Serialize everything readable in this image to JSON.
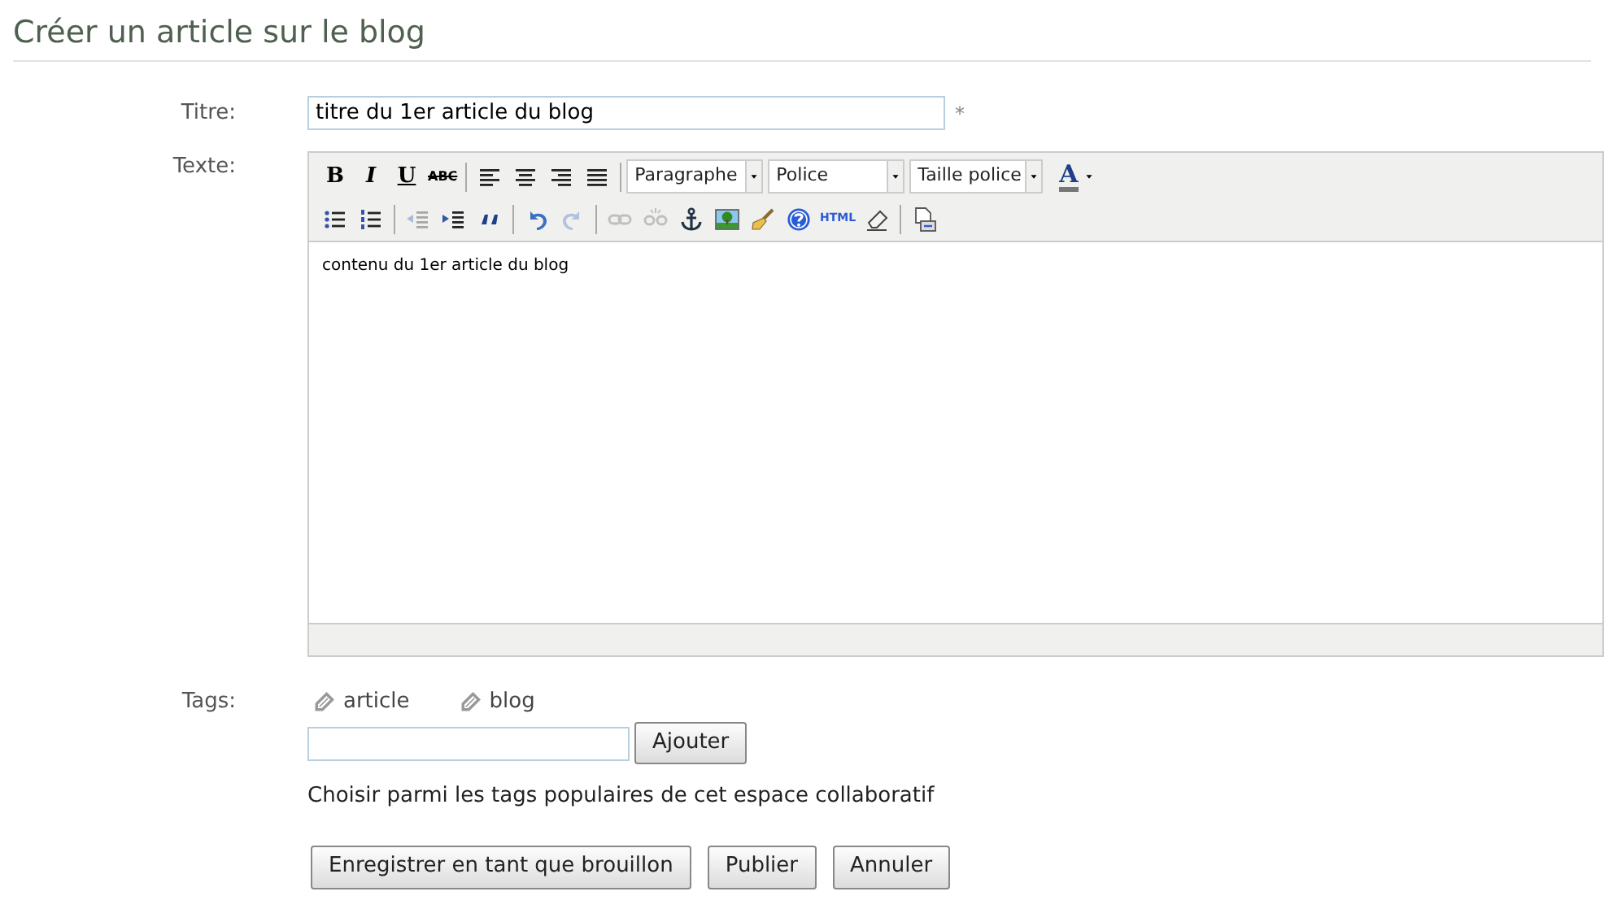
{
  "page_title": "Créer un article sur le blog",
  "title_field": {
    "label": "Titre:",
    "value": "titre du 1er article du blog",
    "required_mark": "*"
  },
  "text_field": {
    "label": "Texte:",
    "toolbar_rows": [
      [
        {
          "kind": "text",
          "label": "B",
          "disabled": false
        },
        {
          "kind": "text",
          "label": "I",
          "disabled": false
        },
        {
          "kind": "text",
          "label": "U",
          "disabled": false
        },
        {
          "kind": "text",
          "label": "ABC",
          "disabled": false
        },
        {
          "kind": "sep"
        },
        {
          "kind": "icon",
          "disabled": false
        },
        {
          "kind": "icon",
          "disabled": false
        },
        {
          "kind": "icon",
          "disabled": false
        },
        {
          "kind": "icon",
          "disabled": false
        },
        {
          "kind": "sep"
        },
        {
          "kind": "select",
          "label": "Paragraphe"
        },
        {
          "kind": "select",
          "label": "Police"
        },
        {
          "kind": "select",
          "label": "Taille police"
        },
        {
          "kind": "color",
          "label": "A"
        }
      ],
      [
        {
          "kind": "icon",
          "disabled": false
        },
        {
          "kind": "icon",
          "disabled": false
        },
        {
          "kind": "sep"
        },
        {
          "kind": "icon",
          "disabled": true
        },
        {
          "kind": "icon",
          "disabled": false
        },
        {
          "kind": "icon",
          "disabled": false
        },
        {
          "kind": "sep"
        },
        {
          "kind": "icon",
          "disabled": false
        },
        {
          "kind": "icon",
          "disabled": true
        },
        {
          "kind": "sep"
        },
        {
          "kind": "icon",
          "disabled": true
        },
        {
          "kind": "icon",
          "disabled": true
        },
        {
          "kind": "icon",
          "disabled": false
        },
        {
          "kind": "icon",
          "disabled": false
        },
        {
          "kind": "icon",
          "disabled": false
        },
        {
          "kind": "icon",
          "disabled": false
        },
        {
          "kind": "text",
          "label": "HTML",
          "disabled": false
        },
        {
          "kind": "icon",
          "disabled": false
        },
        {
          "kind": "sep"
        },
        {
          "kind": "icon",
          "disabled": false
        }
      ]
    ],
    "content": "contenu du 1er article du blog"
  },
  "tags": {
    "label": "Tags:",
    "items": [
      "article",
      "blog"
    ],
    "add_button": "Ajouter",
    "popular_link": "Choisir parmi les tags populaires de cet espace collaboratif"
  },
  "buttons": [
    "Enregistrer en tant que brouillon",
    "Publier",
    "Annuler"
  ]
}
